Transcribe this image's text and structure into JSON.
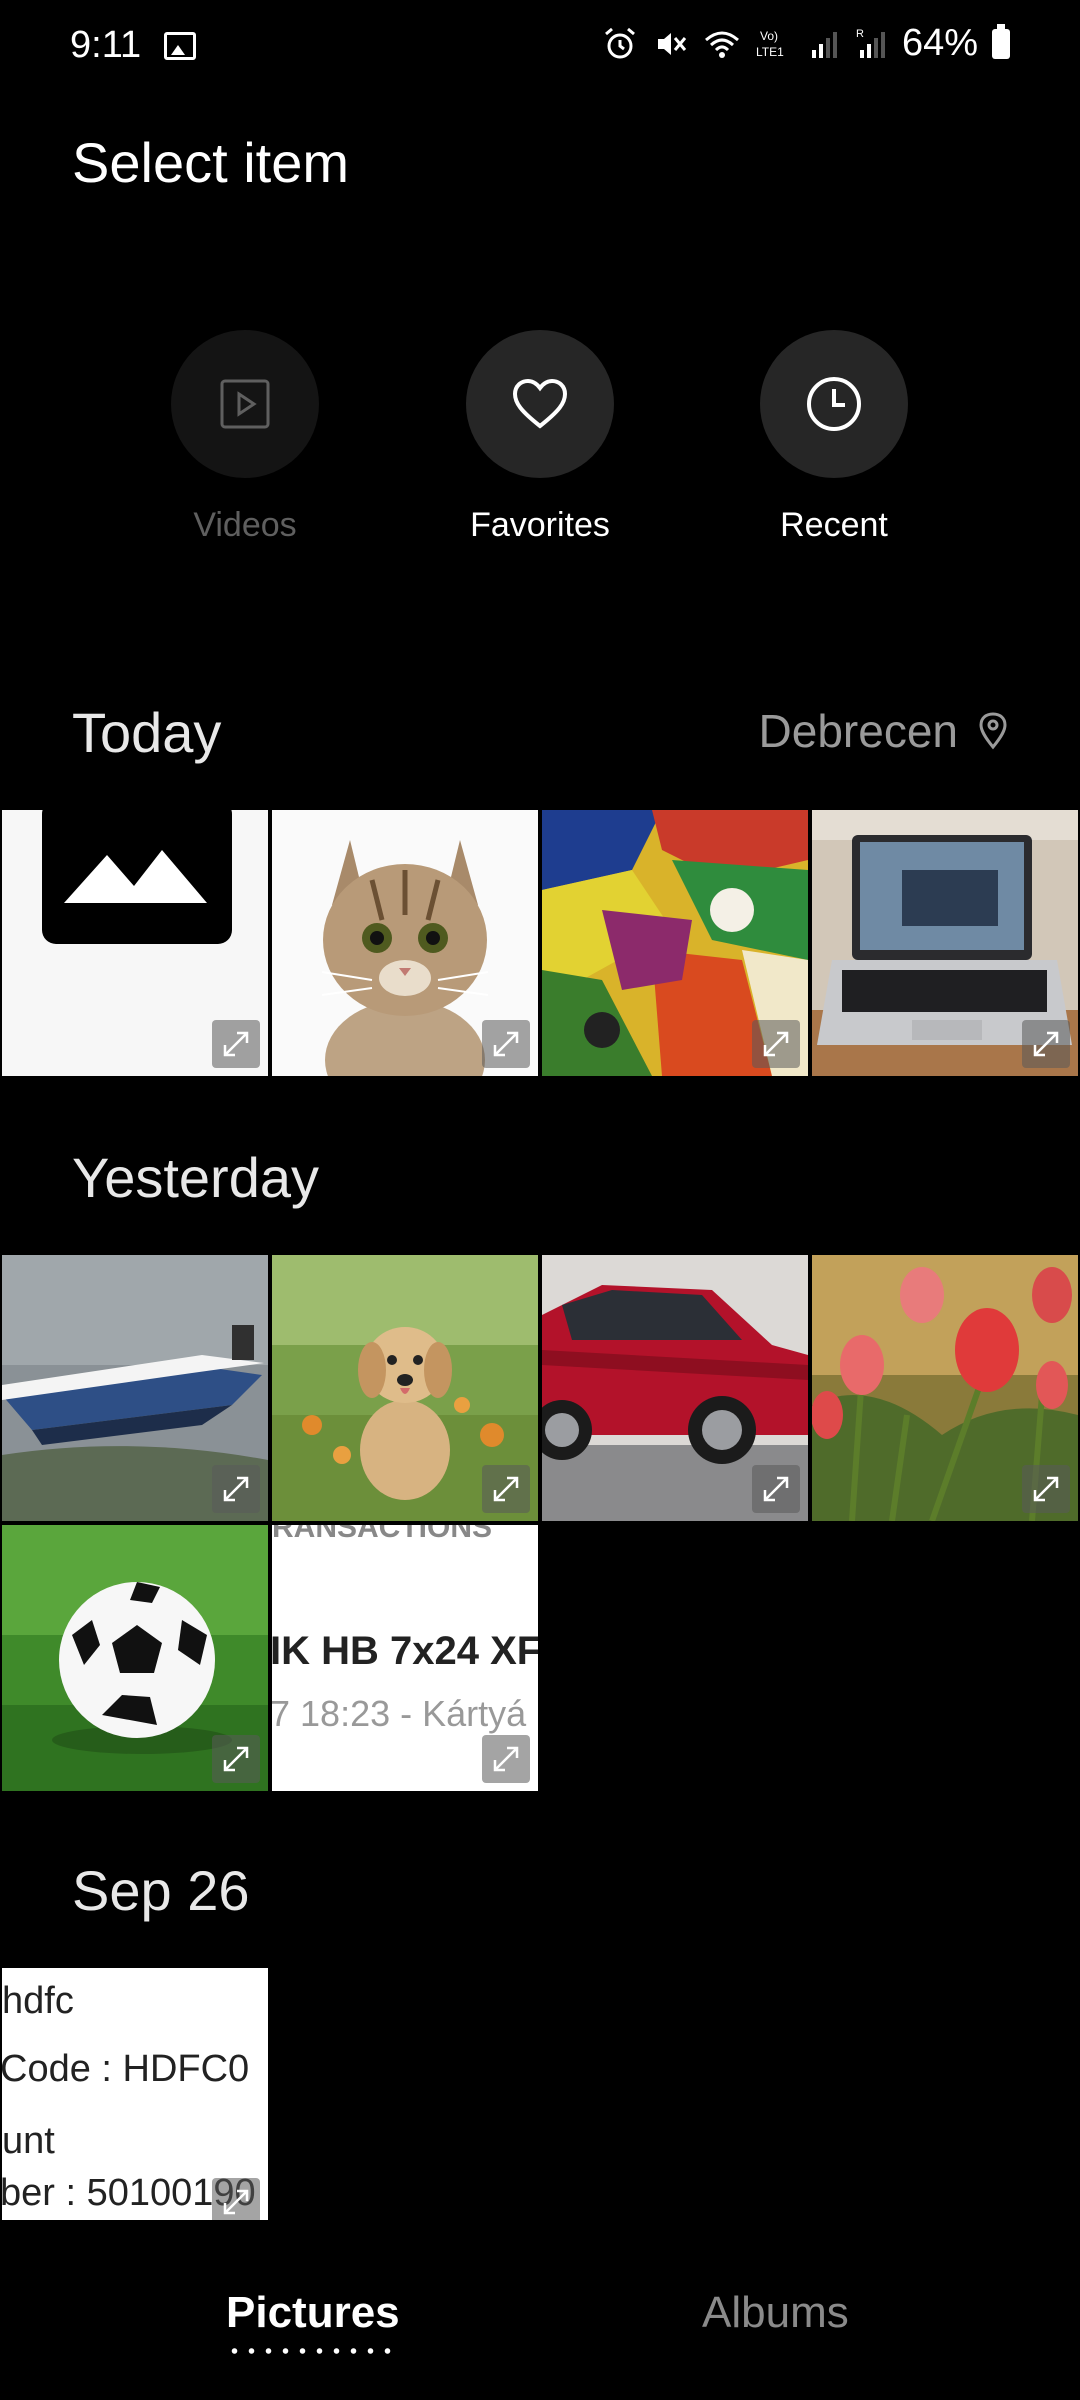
{
  "status_bar": {
    "time": "9:11",
    "battery": "64%"
  },
  "header": {
    "title": "Select item"
  },
  "quick_access": [
    {
      "label": "Videos",
      "icon": "play-square-icon",
      "enabled": false
    },
    {
      "label": "Favorites",
      "icon": "heart-icon",
      "enabled": true
    },
    {
      "label": "Recent",
      "icon": "clock-icon",
      "enabled": true
    }
  ],
  "sections": [
    {
      "title": "Today",
      "location": "Debrecen"
    },
    {
      "title": "Yesterday"
    },
    {
      "title": "Sep 26"
    }
  ],
  "thumb_text": {
    "receipt_lines": [
      "RANSACTIONS",
      "IK HB 7x24 XF",
      "7 18:23 - Kártyá"
    ],
    "bank_lines": [
      "hdfc",
      "Code : HDFC0",
      "unt",
      "ber : 50100190"
    ]
  },
  "tabs": {
    "pictures": "Pictures",
    "albums": "Albums"
  },
  "colors": {
    "background": "#000000",
    "circle": "#262626",
    "muted": "#9a9a9a"
  }
}
